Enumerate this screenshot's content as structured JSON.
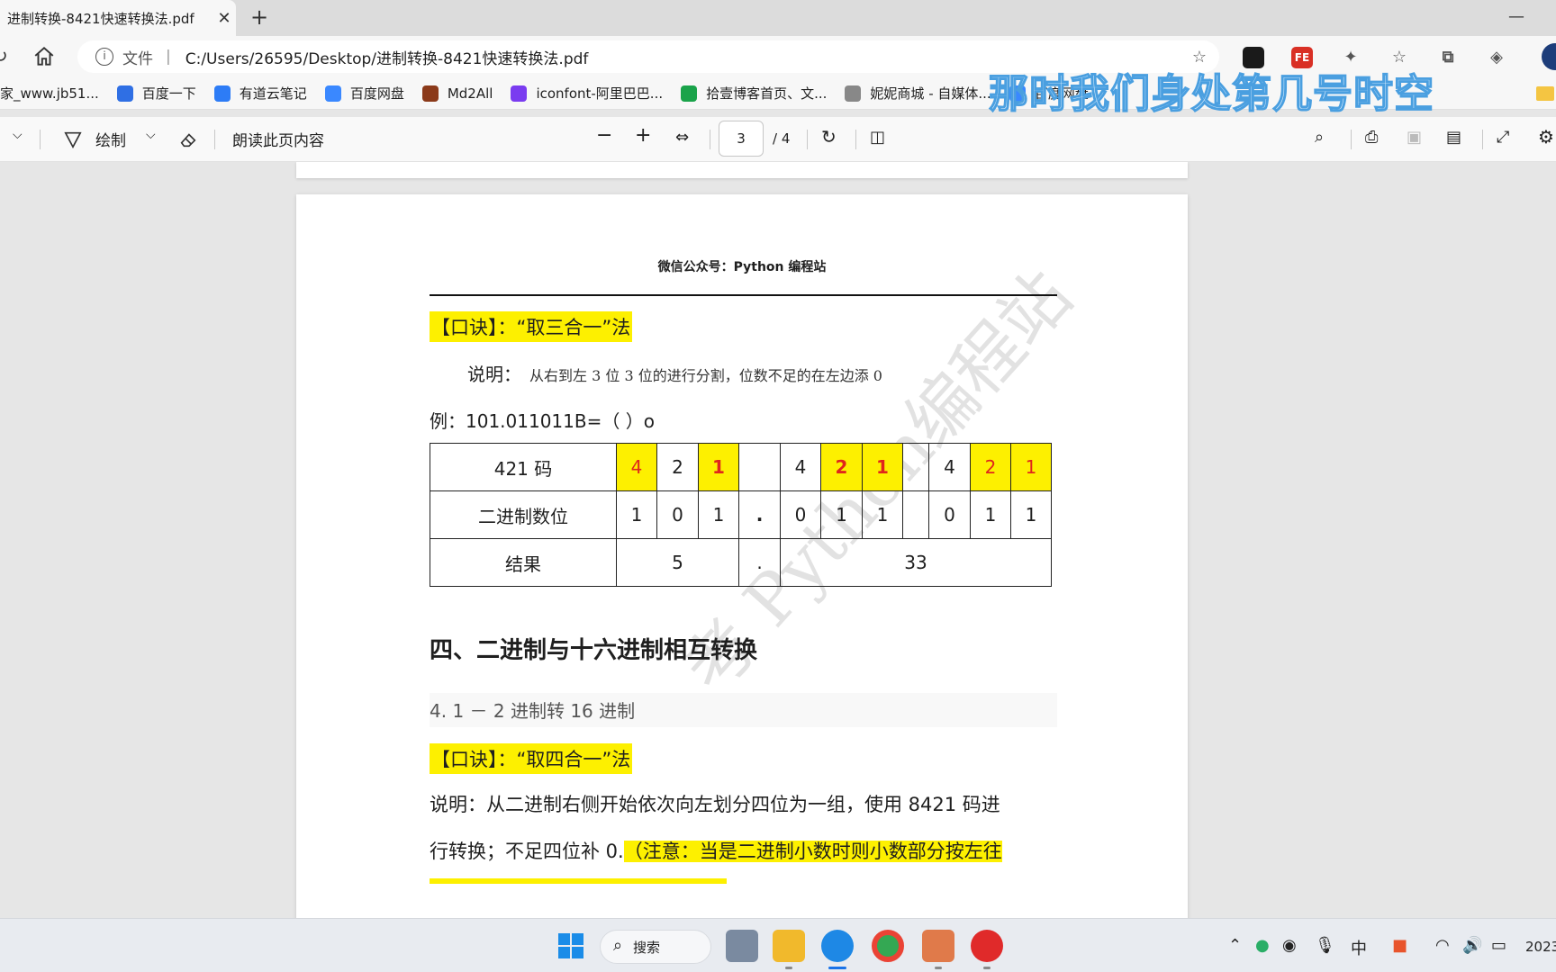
{
  "browser": {
    "tab_title": "进制转换-8421快速转换法.pdf",
    "tab_close": "✕",
    "new_tab": "+",
    "minimize": "—",
    "address_scheme": "文件",
    "address_url": "C:/Users/26595/Desktop/进制转换-8421快速转换法.pdf",
    "extensions": [
      {
        "name": "ext-app-1",
        "text": "",
        "color": "#1a1a1a"
      },
      {
        "name": "ext-fe",
        "text": "FE",
        "color": "#d93025"
      },
      {
        "name": "ext-puzzle",
        "text": "✦",
        "color": "#555555"
      },
      {
        "name": "favorites",
        "text": "☆",
        "color": "#555555"
      },
      {
        "name": "collections",
        "text": "⧉",
        "color": "#555555"
      },
      {
        "name": "performance",
        "text": "◈",
        "color": "#555555"
      }
    ]
  },
  "bookmarks": [
    {
      "label": "家_www.jb51...",
      "color": "transparent"
    },
    {
      "label": "百度一下",
      "color": "#2f6fe4"
    },
    {
      "label": "有道云笔记",
      "color": "#2d7cf6"
    },
    {
      "label": "百度网盘",
      "color": "#3a88ff"
    },
    {
      "label": "Md2All",
      "color": "#8b3a1a"
    },
    {
      "label": "iconfont-阿里巴巴...",
      "color": "#7a3cf0"
    },
    {
      "label": "拾壹博客首页、文...",
      "color": "#1aa34a"
    },
    {
      "label": "妮妮商城 - 自媒体...",
      "color": "#888888"
    },
    {
      "label": "百度网盘",
      "color": "#3a88ff"
    }
  ],
  "overlay_caption": "那时我们身处第几号时空",
  "pdf_toolbar": {
    "draw_label": "绘制",
    "read_aloud_label": "朗读此页内容",
    "current_page": "3",
    "total_pages": "/ 4"
  },
  "page": {
    "header": "微信公众号：Python 编程站",
    "mnemonic1": "【口诀】：“取三合一”法",
    "explain1_label": "说明：",
    "explain1_text": "从右到左 3 位 3 位的进行分割，位数不足的在左边添 0",
    "example": "例：101.011011B=（    ）o",
    "table": {
      "row1_label": "421 码",
      "row1": [
        "4",
        "2",
        "1",
        "",
        "4",
        "2",
        "1",
        "",
        "4",
        "2",
        "1"
      ],
      "row2_label": "二进制数位",
      "row2": [
        "1",
        "0",
        "1",
        ".",
        "0",
        "1",
        "1",
        "",
        "0",
        "1",
        "1"
      ],
      "row3_label": "结果",
      "row3": [
        "5",
        ".",
        "33"
      ]
    },
    "section4_heading": "四、二进制与十六进制相互转换",
    "sub41": "4. 1 － 2 进制转 16 进制",
    "mnemonic2": "【口诀】：“取四合一”法",
    "explain2_line1": "说明：从二进制右侧开始依次向左划分四位为一组，使用 8421 码进",
    "explain2_line2a": "行转换；不足四位补 0.",
    "explain2_line2b": "（注意：当是二进制小数时则小数部分按左往",
    "watermark": "考 Python编程站"
  },
  "taskbar": {
    "search_label": "搜索",
    "ime": "中",
    "clock": "2023"
  }
}
